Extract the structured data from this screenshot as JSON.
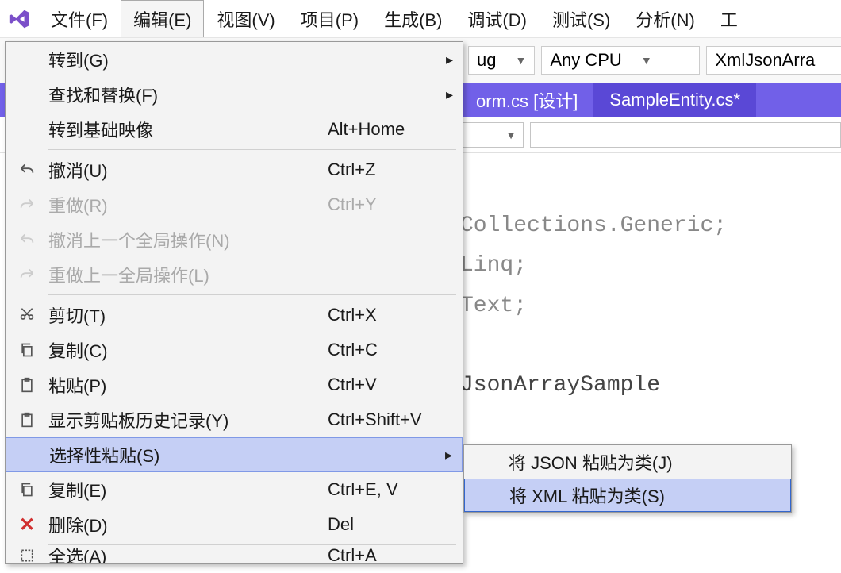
{
  "menubar": {
    "items": [
      "文件(F)",
      "编辑(E)",
      "视图(V)",
      "项目(P)",
      "生成(B)",
      "调试(D)",
      "测试(S)",
      "分析(N)",
      "工"
    ]
  },
  "toolbar": {
    "config": "ug",
    "platform": "Any CPU",
    "startup": "XmlJsonArra"
  },
  "tabs": {
    "t1": "orm.cs [设计]",
    "t2": "SampleEntity.cs*"
  },
  "code": {
    "l1": "Collections.Generic;",
    "l2": "Linq;",
    "l3": "Text;",
    "l4": "JsonArraySample"
  },
  "menu": {
    "goto": "转到(G)",
    "findreplace": "查找和替换(F)",
    "gotobase": {
      "label": "转到基础映像",
      "sc": "Alt+Home"
    },
    "undo": {
      "label": "撤消(U)",
      "sc": "Ctrl+Z"
    },
    "redo": {
      "label": "重做(R)",
      "sc": "Ctrl+Y"
    },
    "undoglobal": "撤消上一个全局操作(N)",
    "redoglobal": "重做上一全局操作(L)",
    "cut": {
      "label": "剪切(T)",
      "sc": "Ctrl+X"
    },
    "copy": {
      "label": "复制(C)",
      "sc": "Ctrl+C"
    },
    "paste": {
      "label": "粘贴(P)",
      "sc": "Ctrl+V"
    },
    "cliphistory": {
      "label": "显示剪贴板历史记录(Y)",
      "sc": "Ctrl+Shift+V"
    },
    "pastespecial": "选择性粘贴(S)",
    "dup": {
      "label": "复制(E)",
      "sc": "Ctrl+E, V"
    },
    "del": {
      "label": "删除(D)",
      "sc": "Del"
    },
    "selectall": {
      "label": "全选(A)",
      "sc": "Ctrl+A"
    }
  },
  "submenu": {
    "json": "将 JSON 粘贴为类(J)",
    "xml": "将 XML 粘贴为类(S)"
  }
}
